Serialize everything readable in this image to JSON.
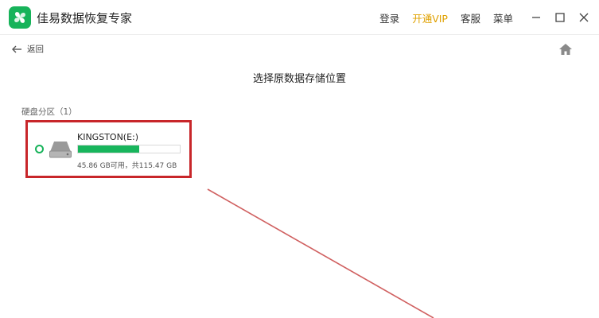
{
  "app": {
    "title": "佳易数据恢复专家",
    "logo_icon": "clover-logo-icon",
    "brand_color": "#17b35a"
  },
  "header": {
    "login_label": "登录",
    "vip_label": "开通VIP",
    "service_label": "客服",
    "menu_label": "菜单",
    "vip_color": "#e0a100"
  },
  "nav": {
    "back_label": "返回",
    "home_icon": "home-icon"
  },
  "main": {
    "title": "选择原数据存储位置",
    "section_label": "硬盘分区（1）",
    "drives": [
      {
        "name": "KINGSTON(E:)",
        "usage_fraction": 0.6,
        "size_text": "45.86 GB可用，共115.47 GB",
        "selected": false,
        "highlight_color": "#c8262a"
      }
    ]
  }
}
